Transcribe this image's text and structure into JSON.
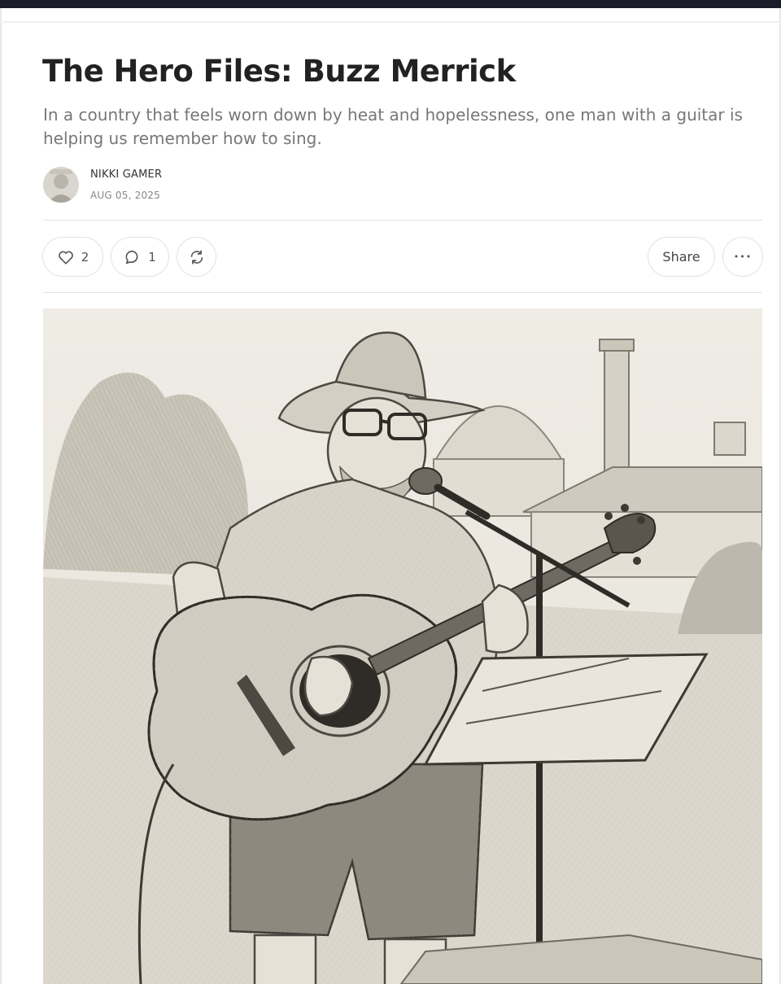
{
  "post": {
    "title": "The Hero Files: Buzz Merrick",
    "subtitle": "In a country that feels worn down by heat and hopelessness, one man with a guitar is helping us remember how to sing.",
    "author": "NIKKI GAMER",
    "date": "AUG 05, 2025"
  },
  "actions": {
    "like_count": "2",
    "comment_count": "1",
    "share_label": "Share",
    "more_label": "•••"
  },
  "icons": {
    "like": "heart-icon",
    "comment": "speech-bubble-icon",
    "restack": "restack-arrows-icon",
    "more": "ellipsis-icon"
  },
  "colors": {
    "topbar": "#1a1d27",
    "title": "#222222",
    "subtitle": "#777777",
    "border": "#e2e2e2"
  }
}
